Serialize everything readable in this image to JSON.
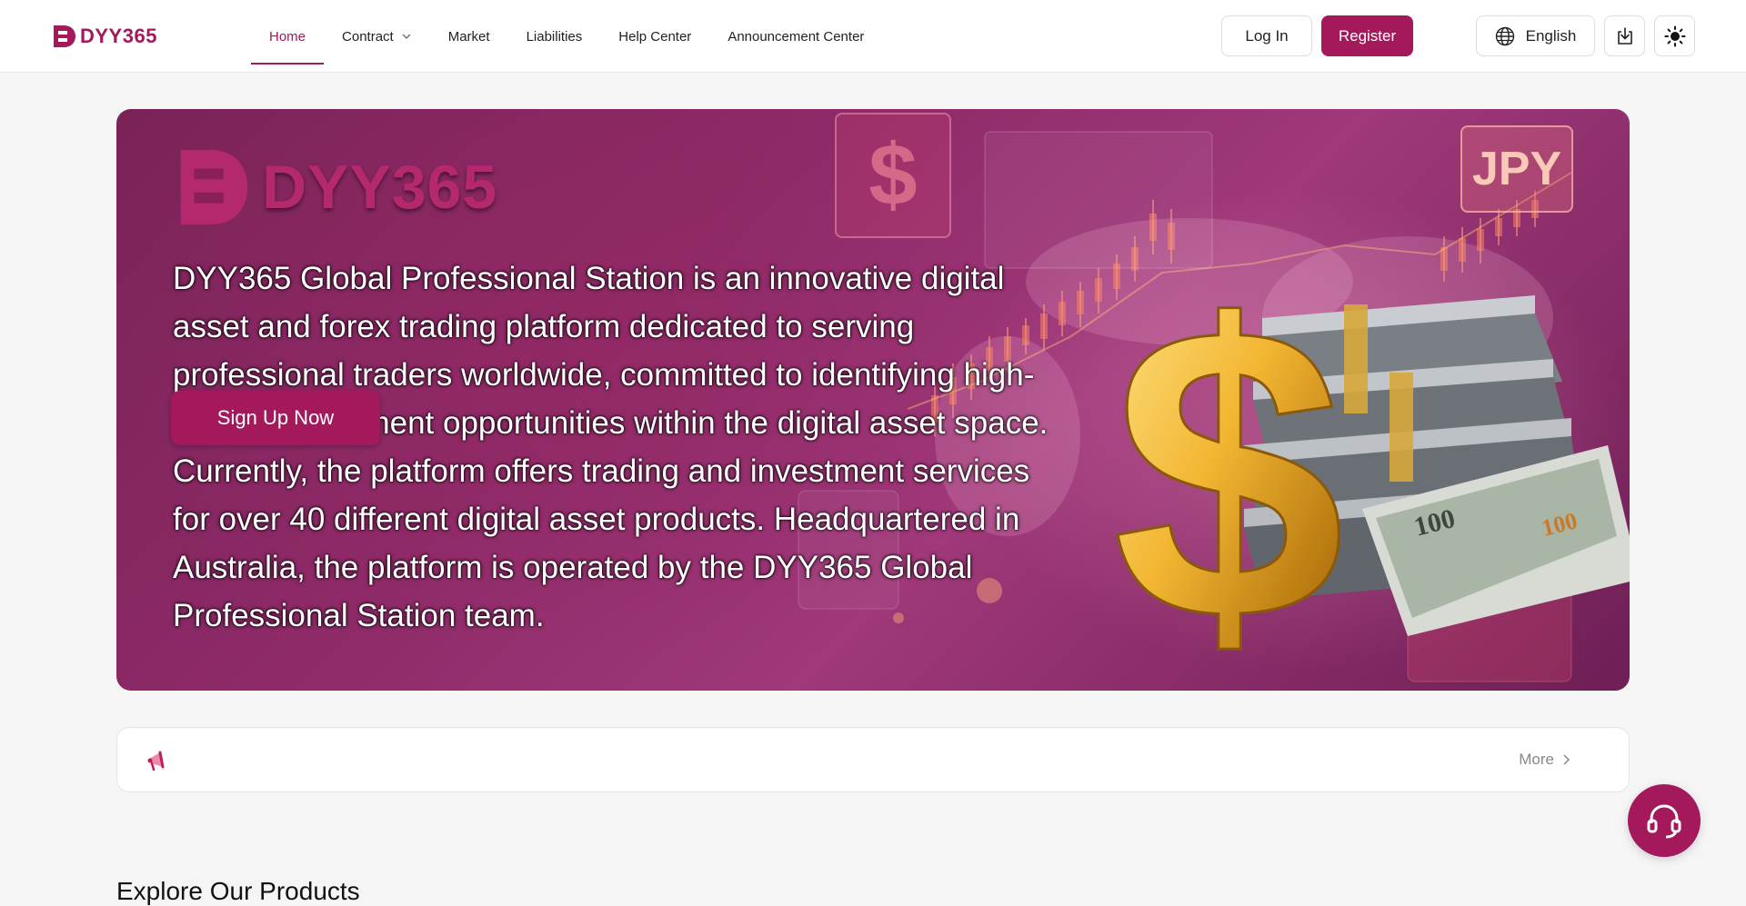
{
  "brand": {
    "name": "DYY365",
    "accent": "#a3195b"
  },
  "nav": {
    "items": [
      {
        "label": "Home",
        "active": true
      },
      {
        "label": "Contract",
        "has_dropdown": true
      },
      {
        "label": "Market"
      },
      {
        "label": "Liabilities"
      },
      {
        "label": "Help Center"
      },
      {
        "label": "Announcement Center"
      }
    ]
  },
  "header": {
    "login_label": "Log In",
    "register_label": "Register",
    "language_label": "English",
    "icons": [
      "globe-icon",
      "download-icon",
      "sun-icon"
    ]
  },
  "banner": {
    "logo_text": "DYY365",
    "description": "DYY365 Global Professional Station is an innovative digital asset and forex trading platform dedicated to serving professional traders worldwide, committed to identifying high-quality, investment opportunities within the digital asset space. Currently, the platform offers trading and investment services for over 40 different digital asset products. Headquartered in Australia, the platform is operated by the DYY365 Global Professional Station team.",
    "signup_label": "Sign Up Now",
    "currency_badges": [
      "$",
      "JPY"
    ]
  },
  "announcement": {
    "icon": "megaphone-icon",
    "more_label": "More"
  },
  "products": {
    "title": "Explore Our Products"
  },
  "support": {
    "icon": "headset-icon"
  }
}
